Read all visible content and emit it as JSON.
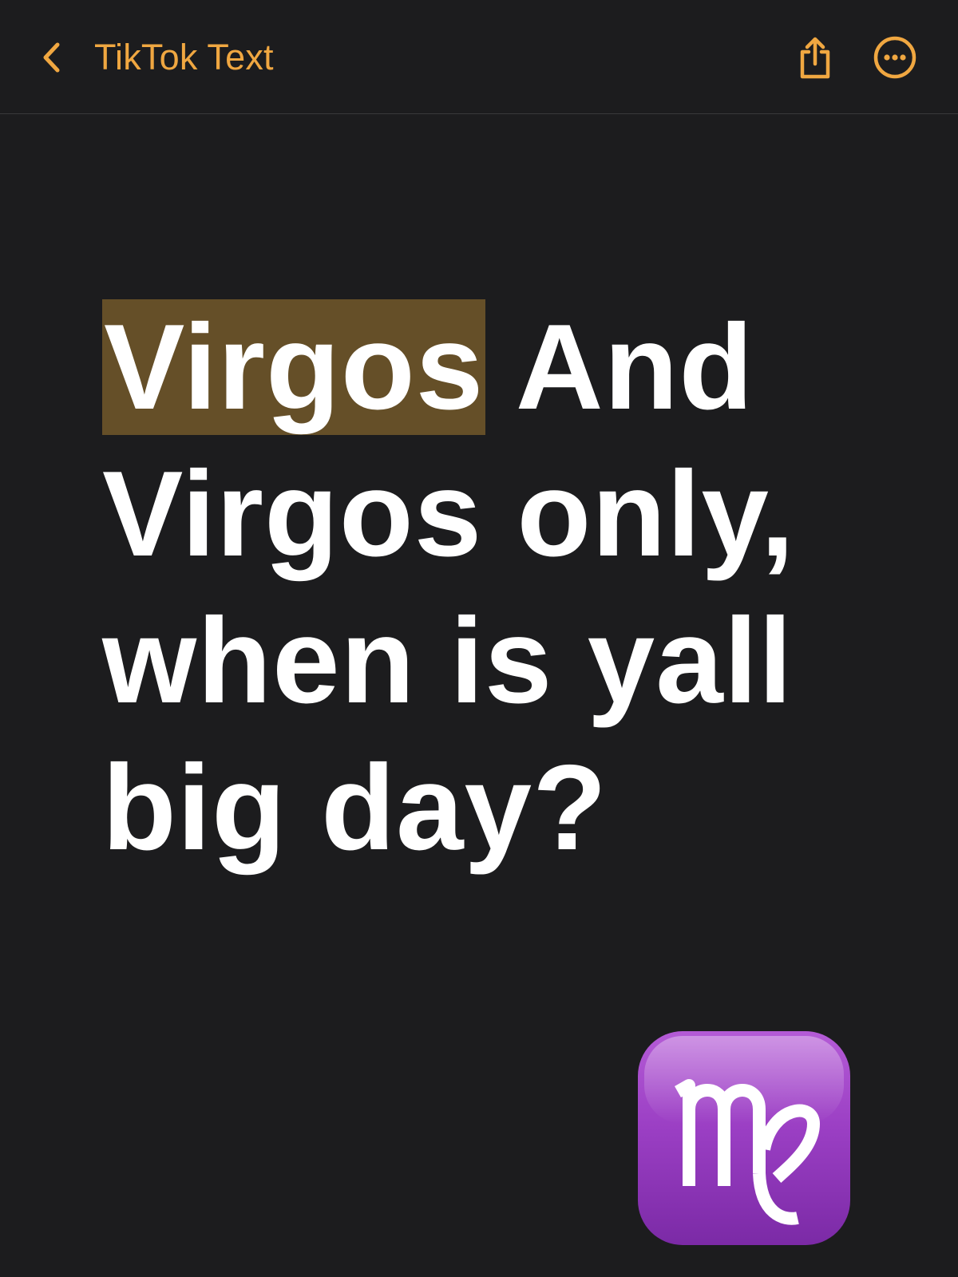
{
  "nav": {
    "back_label": "TikTok Text",
    "back_icon": "chevron-left-icon",
    "share_icon": "share-icon",
    "more_icon": "ellipsis-circle-icon"
  },
  "note": {
    "highlighted_word": "Virgos",
    "line1_rest": " And",
    "line2": "Virgos only,",
    "line3": "when is yall",
    "line4": "big day?",
    "emoji": "virgo-sign-icon"
  },
  "colors": {
    "accent": "#f0a741",
    "background": "#1c1c1e",
    "highlight": "#654f28",
    "text": "#ffffff",
    "emoji_purple": "#9b3fc4"
  }
}
